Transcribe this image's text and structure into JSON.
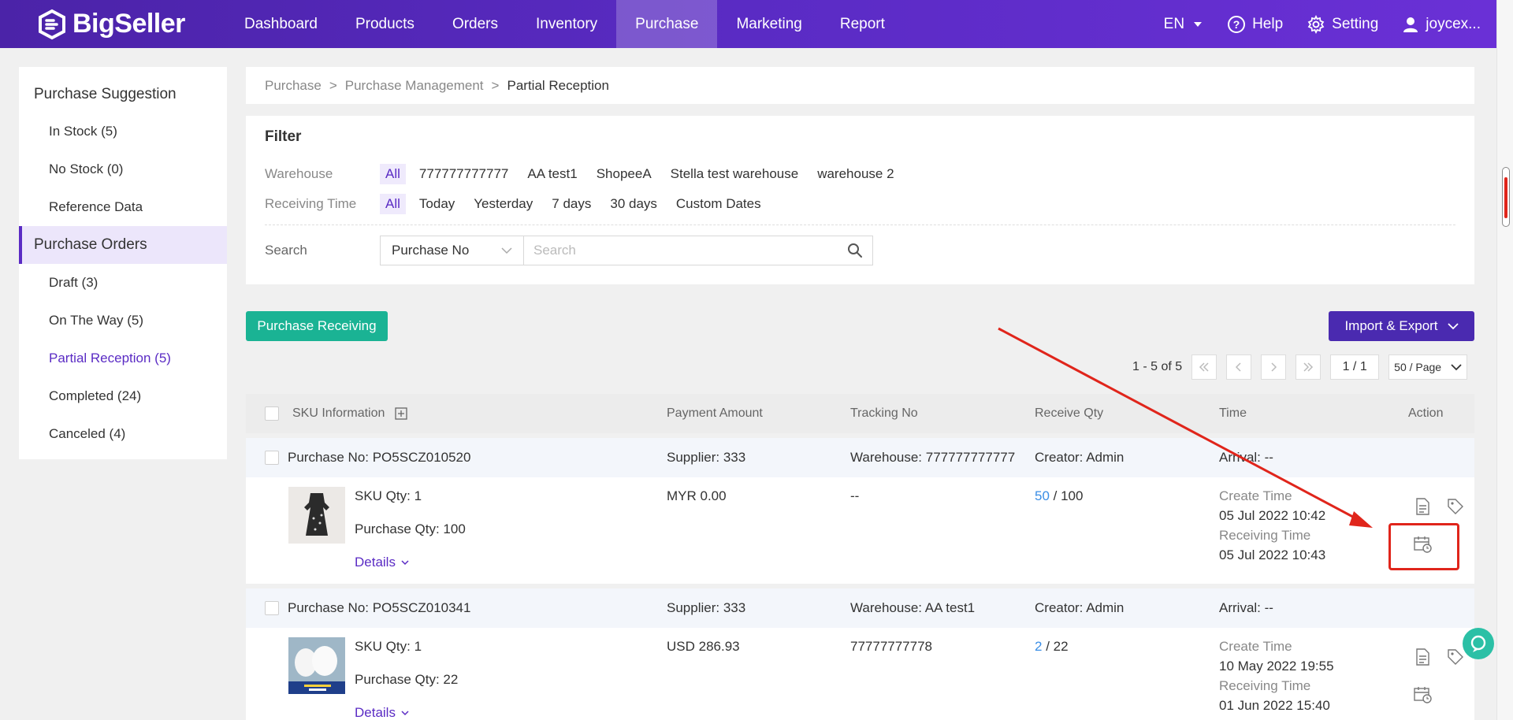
{
  "brand": "BigSeller",
  "nav": {
    "items": [
      "Dashboard",
      "Products",
      "Orders",
      "Inventory",
      "Purchase",
      "Marketing",
      "Report"
    ],
    "active": "Purchase",
    "lang": "EN",
    "help": "Help",
    "setting": "Setting",
    "user": "joycex..."
  },
  "sidebar": {
    "group1": "Purchase Suggestion",
    "items1": [
      "In Stock (5)",
      "No Stock (0)",
      "Reference Data"
    ],
    "group2": "Purchase Orders",
    "items2": [
      "Draft (3)",
      "On The Way (5)",
      "Partial Reception (5)",
      "Completed (24)",
      "Canceled (4)"
    ]
  },
  "breadcrumb": [
    "Purchase",
    "Purchase Management",
    "Partial Reception"
  ],
  "filter": {
    "title": "Filter",
    "warehouse_label": "Warehouse",
    "warehouses": [
      "All",
      "777777777777",
      "AA test1",
      "ShopeeA",
      "Stella test warehouse",
      "warehouse 2"
    ],
    "time_label": "Receiving Time",
    "times": [
      "All",
      "Today",
      "Yesterday",
      "7 days",
      "30 days",
      "Custom Dates"
    ],
    "search_label": "Search",
    "search_type": "Purchase No",
    "search_placeholder": "Search"
  },
  "buttons": {
    "receiving": "Purchase Receiving",
    "import_export": "Import & Export"
  },
  "pager": {
    "range": "1 - 5 of 5",
    "page": "1 / 1",
    "size": "50 / Page"
  },
  "table": {
    "headers": [
      "SKU Information",
      "Payment Amount",
      "Tracking No",
      "Receive Qty",
      "Time",
      "Action"
    ]
  },
  "orders": [
    {
      "purchase_no": "Purchase No: PO5SCZ010520",
      "supplier": "Supplier: 333",
      "warehouse": "Warehouse: 777777777777",
      "creator": "Creator: Admin",
      "arrival": "Arrival: --",
      "sku_qty": "SKU Qty: 1",
      "purchase_qty": "Purchase Qty: 100",
      "details": "Details",
      "amount": "MYR 0.00",
      "tracking": "--",
      "received": "50",
      "total": "/ 100",
      "create_label": "Create Time",
      "create_time": "05 Jul 2022 10:42",
      "receiving_label": "Receiving Time",
      "receiving_time": "05 Jul 2022 10:43"
    },
    {
      "purchase_no": "Purchase No: PO5SCZ010341",
      "supplier": "Supplier: 333",
      "warehouse": "Warehouse: AA test1",
      "creator": "Creator: Admin",
      "arrival": "Arrival: --",
      "sku_qty": "SKU Qty: 1",
      "purchase_qty": "Purchase Qty: 22",
      "details": "Details",
      "amount": "USD 286.93",
      "tracking": "77777777778",
      "received": "2",
      "total": "/ 22",
      "create_label": "Create Time",
      "create_time": "10 May 2022 19:55",
      "receiving_label": "Receiving Time",
      "receiving_time": "01 Jun 2022 15:40"
    }
  ],
  "colors": {
    "brand": "#5a2bc4",
    "green": "#1ab394",
    "link": "#3a8ee6",
    "annotation": "#e0251b"
  }
}
